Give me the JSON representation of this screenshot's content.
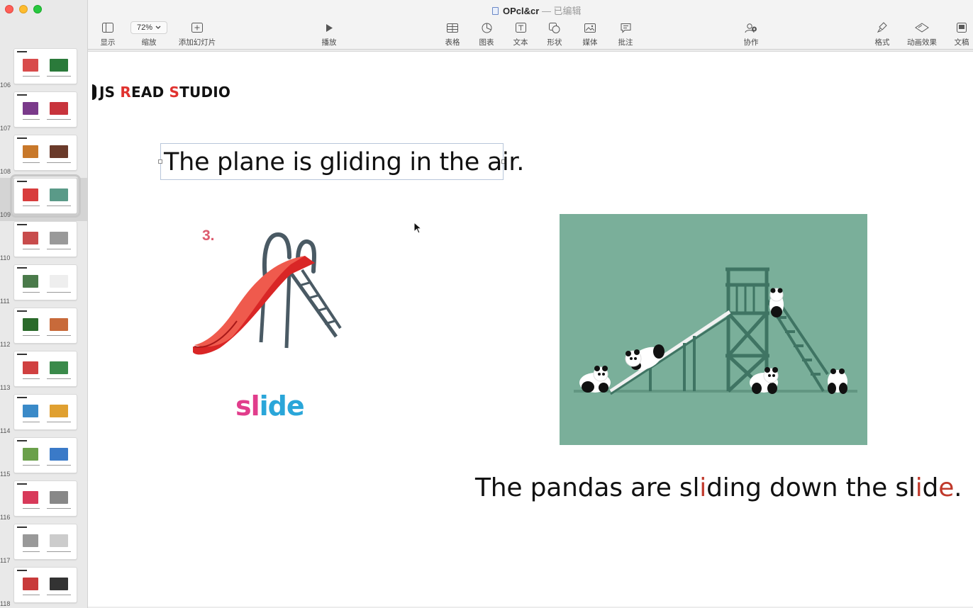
{
  "window": {
    "title": "OPcl&cr",
    "status": "— 已编辑"
  },
  "toolbar": {
    "view": "显示",
    "zoom_value": "72%",
    "zoom": "缩放",
    "add_slide": "添加幻灯片",
    "play": "播放",
    "table": "表格",
    "chart": "图表",
    "text": "文本",
    "shape": "形状",
    "media": "媒体",
    "comment": "批注",
    "collaborate": "协作",
    "format": "格式",
    "animate": "动画效果",
    "document": "文稿"
  },
  "sidebar": {
    "slides": [
      {
        "num": "106"
      },
      {
        "num": "107"
      },
      {
        "num": "108"
      },
      {
        "num": "109",
        "active": true
      },
      {
        "num": "110"
      },
      {
        "num": "111"
      },
      {
        "num": "112"
      },
      {
        "num": "113"
      },
      {
        "num": "114"
      },
      {
        "num": "115"
      },
      {
        "num": "116"
      },
      {
        "num": "117"
      },
      {
        "num": "118"
      }
    ]
  },
  "slide": {
    "brand_a": "JS ",
    "brand_r": "R",
    "brand_b": "EAD ",
    "brand_s": "S",
    "brand_c": "TUDIO",
    "sentence": "The plane is gliding in the air.",
    "number": "3.",
    "word_a": "sl",
    "word_b": "ide",
    "caption_1": "The pandas are sl",
    "caption_2": "i",
    "caption_3": "ding down the sl",
    "caption_4": "i",
    "caption_5": "d",
    "caption_6": "e",
    "caption_7": "."
  },
  "colors": {
    "accent_red": "#e0322f",
    "word_pink": "#e13d8c",
    "word_blue": "#2aa6d9",
    "photo_bg": "#7aaf9a"
  }
}
